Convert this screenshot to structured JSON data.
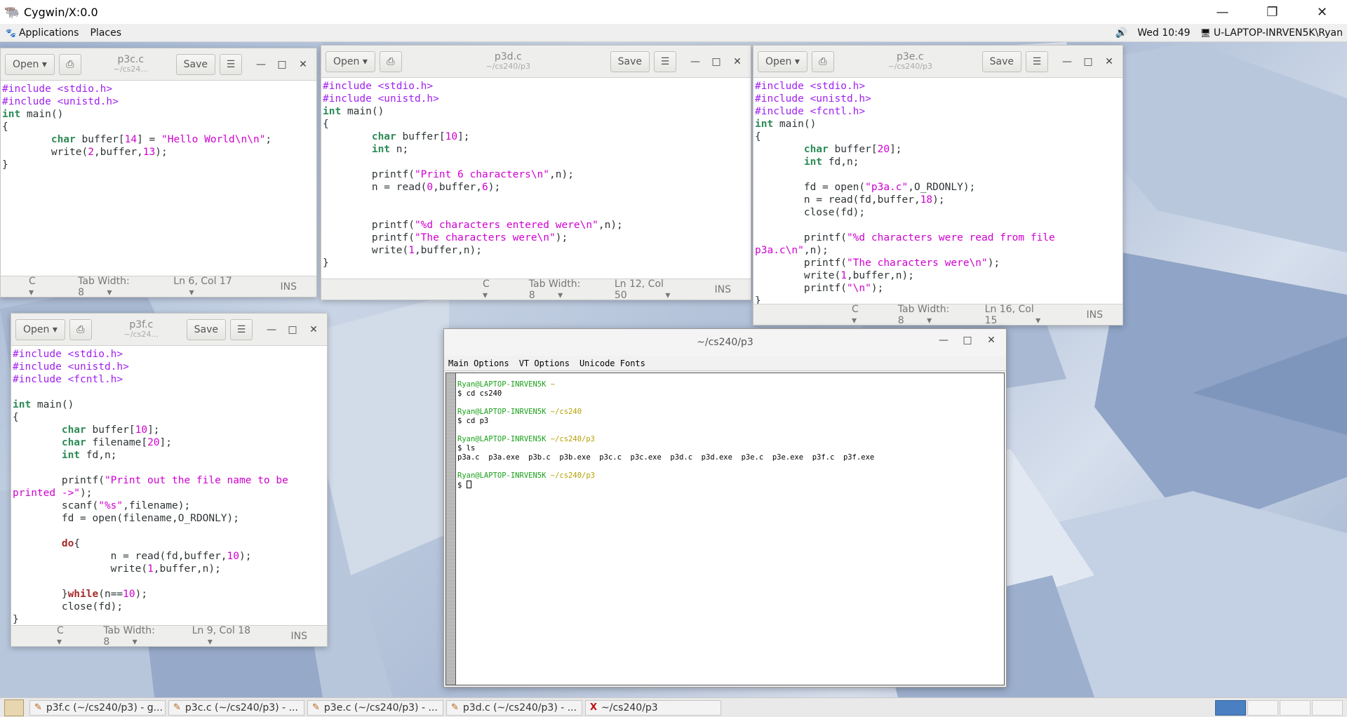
{
  "host_window": {
    "title": "Cygwin/X:0.0",
    "logo_icon": "gnu-icon"
  },
  "panel": {
    "applications": "Applications",
    "places": "Places",
    "clock": "Wed 10:49",
    "user": "U-LAPTOP-INRVEN5K\\Ryan"
  },
  "editors": {
    "p3c": {
      "open": "Open",
      "save": "Save",
      "title": "p3c.c",
      "path": "~/cs24...",
      "lang": "C",
      "tab": "Tab Width: 8",
      "pos": "Ln 6, Col 17",
      "mode": "INS"
    },
    "p3d": {
      "open": "Open",
      "save": "Save",
      "title": "p3d.c",
      "path": "~/cs240/p3",
      "lang": "C",
      "tab": "Tab Width: 8",
      "pos": "Ln 12, Col 50",
      "mode": "INS"
    },
    "p3e": {
      "open": "Open",
      "save": "Save",
      "title": "p3e.c",
      "path": "~/cs240/p3",
      "lang": "C",
      "tab": "Tab Width: 8",
      "pos": "Ln 16, Col 15",
      "mode": "INS"
    },
    "p3f": {
      "open": "Open",
      "save": "Save",
      "title": "p3f.c",
      "path": "~/cs24...",
      "lang": "C",
      "tab": "Tab Width: 8",
      "pos": "Ln 9, Col 18",
      "mode": "INS"
    }
  },
  "xterm": {
    "title": "~/cs240/p3",
    "menu": [
      "Main Options",
      "VT Options",
      "Unicode Fonts"
    ],
    "prompt_user": "Ryan@LAPTOP-INRVEN5K",
    "prompt_paths": [
      "~",
      "~/cs240",
      "~/cs240/p3",
      "~/cs240/p3"
    ],
    "commands": [
      "$ cd cs240",
      "$ cd p3",
      "$ ls",
      "$ "
    ],
    "ls_output": "p3a.c  p3a.exe  p3b.c  p3b.exe  p3c.c  p3c.exe  p3d.c  p3d.exe  p3e.c  p3e.exe  p3f.c  p3f.exe"
  },
  "taskbar": {
    "tasks": [
      "p3f.c (~/cs240/p3) - g...",
      "p3c.c (~/cs240/p3) - ...",
      "p3e.c (~/cs240/p3) - ...",
      "p3d.c (~/cs240/p3) - ...",
      "~/cs240/p3"
    ]
  }
}
